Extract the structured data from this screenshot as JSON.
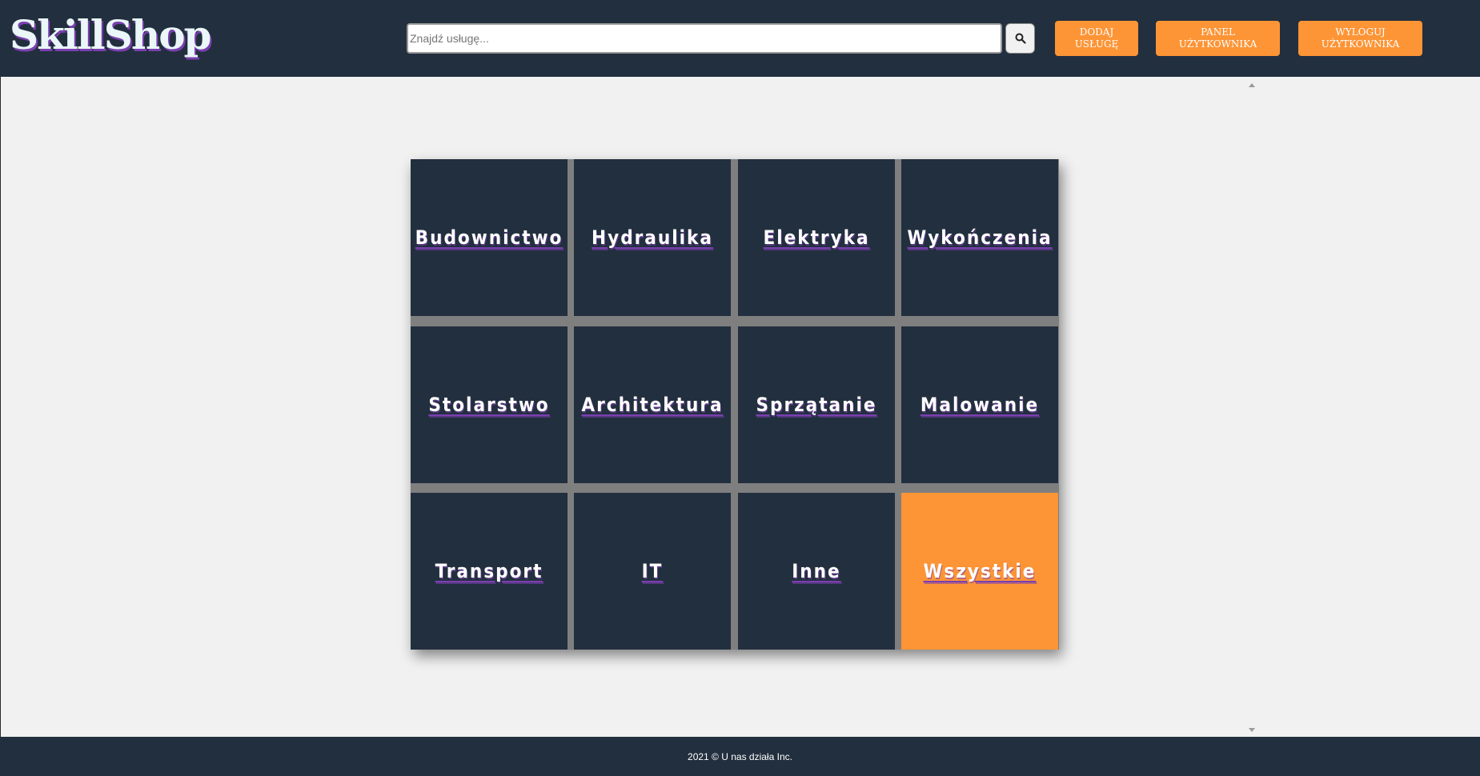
{
  "header": {
    "logo": "SkillShop",
    "search": {
      "placeholder": "Znajdź usługę...",
      "value": "",
      "button_icon": "search-icon"
    },
    "buttons": {
      "add_service": [
        "DODAJ",
        "USŁUGĘ"
      ],
      "user_panel": [
        "PANEL",
        "UŻYTKOWNIKA"
      ],
      "logout": [
        "WYLOGUJ",
        "UŻYTKOWNIKA"
      ]
    }
  },
  "categories": [
    "Budownictwo",
    "Hydraulika",
    "Elektryka",
    "Wykończenia",
    "Stolarstwo",
    "Architektura",
    "Sprzątanie",
    "Malowanie",
    "Transport",
    "IT",
    "Inne",
    "Wszystkie"
  ],
  "active_category": "Wszystkie",
  "footer": {
    "text": "2021 © U nas działa Inc."
  },
  "colors": {
    "header_bg": "#222f3e",
    "accent": "#fd9435",
    "tile_bg": "#222f3e",
    "page_bg": "#f1f1f1",
    "underline": "#7b3fb0"
  }
}
